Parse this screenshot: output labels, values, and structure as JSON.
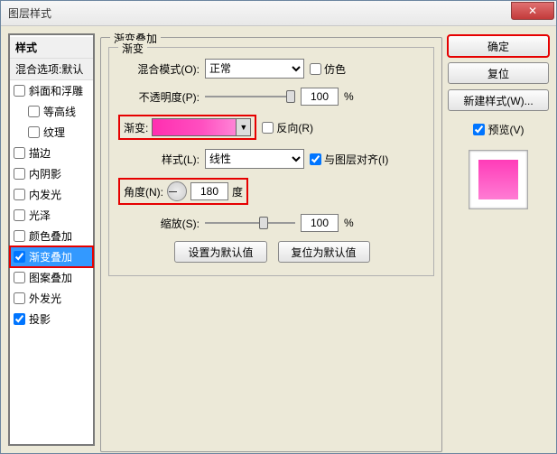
{
  "window": {
    "title": "图层样式"
  },
  "left": {
    "header": "样式",
    "sub": "混合选项:默认",
    "items": [
      {
        "label": "斜面和浮雕",
        "checked": false
      },
      {
        "label": "等高线",
        "checked": false,
        "indent": true
      },
      {
        "label": "纹理",
        "checked": false,
        "indent": true
      },
      {
        "label": "描边",
        "checked": false
      },
      {
        "label": "内阴影",
        "checked": false
      },
      {
        "label": "内发光",
        "checked": false
      },
      {
        "label": "光泽",
        "checked": false
      },
      {
        "label": "颜色叠加",
        "checked": false
      },
      {
        "label": "渐变叠加",
        "checked": true,
        "selected": true
      },
      {
        "label": "图案叠加",
        "checked": false
      },
      {
        "label": "外发光",
        "checked": false
      },
      {
        "label": "投影",
        "checked": true
      }
    ]
  },
  "mid": {
    "group_title": "渐变叠加",
    "inner_title": "渐变",
    "blend_label": "混合模式(O):",
    "blend_value": "正常",
    "dither_label": "仿色",
    "opacity_label": "不透明度(P):",
    "opacity_value": "100",
    "percent": "%",
    "gradient_label": "渐变:",
    "reverse_label": "反向(R)",
    "style_label": "样式(L):",
    "style_value": "线性",
    "align_label": "与图层对齐(I)",
    "angle_label": "角度(N):",
    "angle_value": "180",
    "angle_unit": "度",
    "scale_label": "缩放(S):",
    "scale_value": "100",
    "btn_default": "设置为默认值",
    "btn_reset": "复位为默认值"
  },
  "right": {
    "ok": "确定",
    "reset": "复位",
    "new_style": "新建样式(W)...",
    "preview_label": "预览(V)"
  },
  "colors": {
    "gradient": [
      "#ff2eb0",
      "#ff9ae0"
    ],
    "highlight": "#e60000"
  }
}
